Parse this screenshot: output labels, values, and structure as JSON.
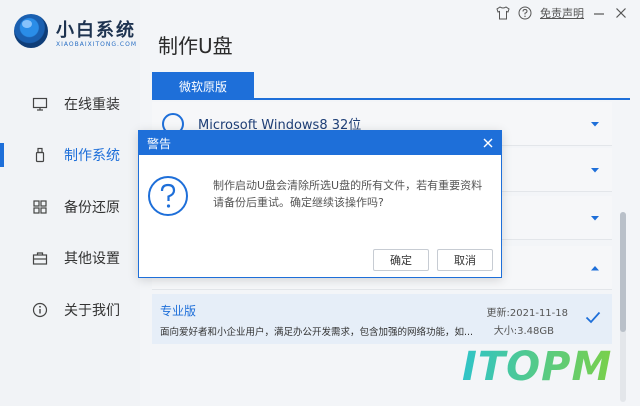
{
  "app": {
    "logo_title": "小白系统",
    "logo_subtitle": "XIAOBAIXITONG.COM",
    "page_title": "制作U盘"
  },
  "topbar": {
    "free_link": "免责声明",
    "icons": [
      "shirt-icon",
      "help-circle-icon",
      "minimize-icon",
      "close-icon"
    ]
  },
  "sidebar": {
    "items": [
      {
        "label": "在线重装",
        "icon": "monitor-icon",
        "active": false
      },
      {
        "label": "制作系统",
        "icon": "usb-drive-icon",
        "active": true
      },
      {
        "label": "备份还原",
        "icon": "grid-icon",
        "active": false
      },
      {
        "label": "其他设置",
        "icon": "briefcase-icon",
        "active": false
      },
      {
        "label": "关于我们",
        "icon": "info-icon",
        "active": false
      }
    ]
  },
  "main": {
    "tab_label": "微软原版",
    "os_list": [
      {
        "name": "Microsoft Windows8 32位"
      }
    ],
    "selected": {
      "name": "专业版",
      "description": "面向爱好者和小企业用户，满足办公开发需求，包含加强的网络功能，如...",
      "updated": "更新:2021-11-18",
      "size": "大小:3.48GB"
    }
  },
  "dialog": {
    "title": "警告",
    "message": "制作启动U盘会清除所选U盘的所有文件，若有重要资料请备份后重试。确定继续该操作吗?",
    "ok_label": "确定",
    "cancel_label": "取消"
  },
  "watermark": "ITOPM",
  "colors": {
    "accent": "#1e6fd9",
    "sidebar_bg": "#f1f3f6",
    "selected_bg": "#e6eef8"
  }
}
